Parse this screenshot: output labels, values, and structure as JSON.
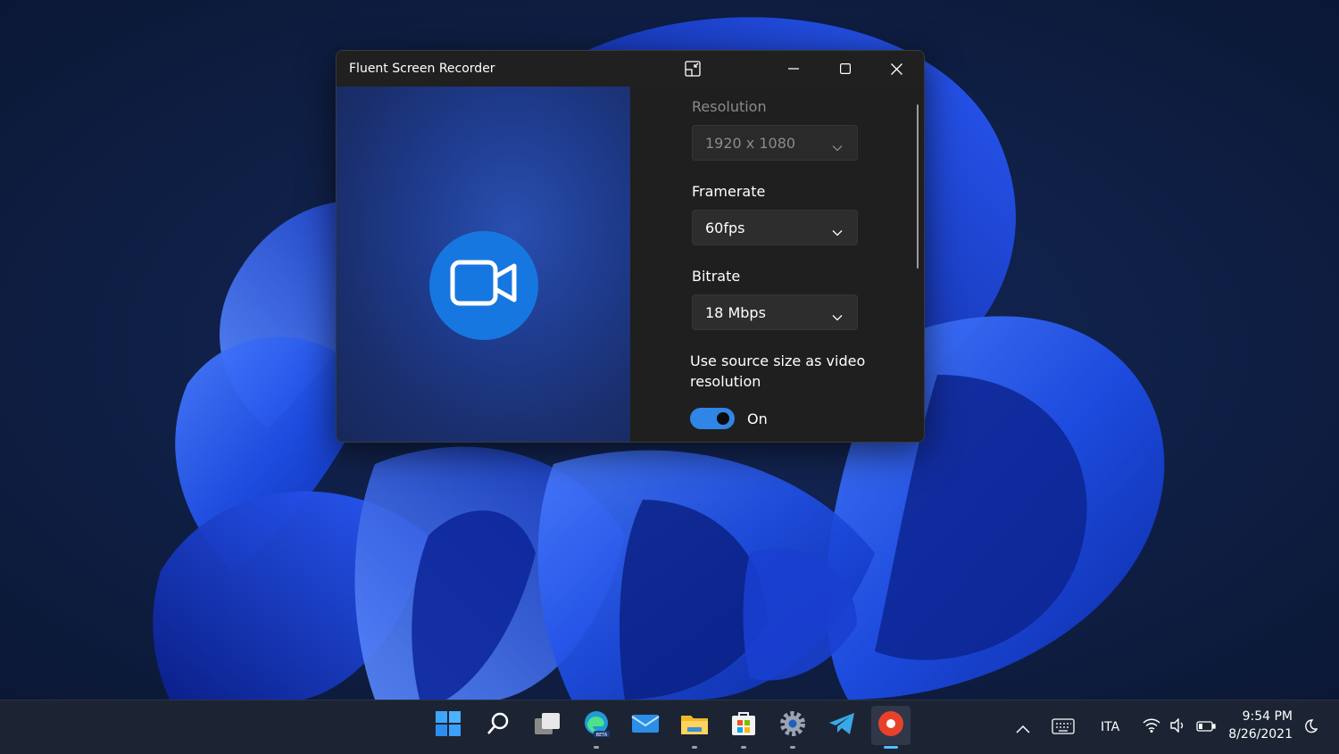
{
  "window": {
    "title": "Fluent Screen Recorder",
    "controls": [
      "compact-overlay",
      "minimize",
      "maximize",
      "close"
    ]
  },
  "settings": {
    "resolution": {
      "label": "Resolution",
      "value": "1920 x 1080",
      "enabled": false
    },
    "framerate": {
      "label": "Framerate",
      "value": "60fps"
    },
    "bitrate": {
      "label": "Bitrate",
      "value": "18 Mbps"
    },
    "source_size": {
      "label": "Use source size as video resolution",
      "state": "On",
      "checked": true
    }
  },
  "taskbar": {
    "apps": [
      "start-icon",
      "search-icon",
      "task-view-icon",
      "edge-beta-icon",
      "mail-icon",
      "file-explorer-icon",
      "store-icon",
      "settings-icon",
      "telegram-icon",
      "screen-recorder-icon"
    ],
    "tray": {
      "language": "ITA",
      "time": "9:54 PM",
      "date": "8/26/2021"
    }
  },
  "colors": {
    "accent": "#1777e0",
    "toggle_on": "#2f86e6",
    "window_bg": "#1f1f1f",
    "taskbar_bg": "#1c2433"
  }
}
